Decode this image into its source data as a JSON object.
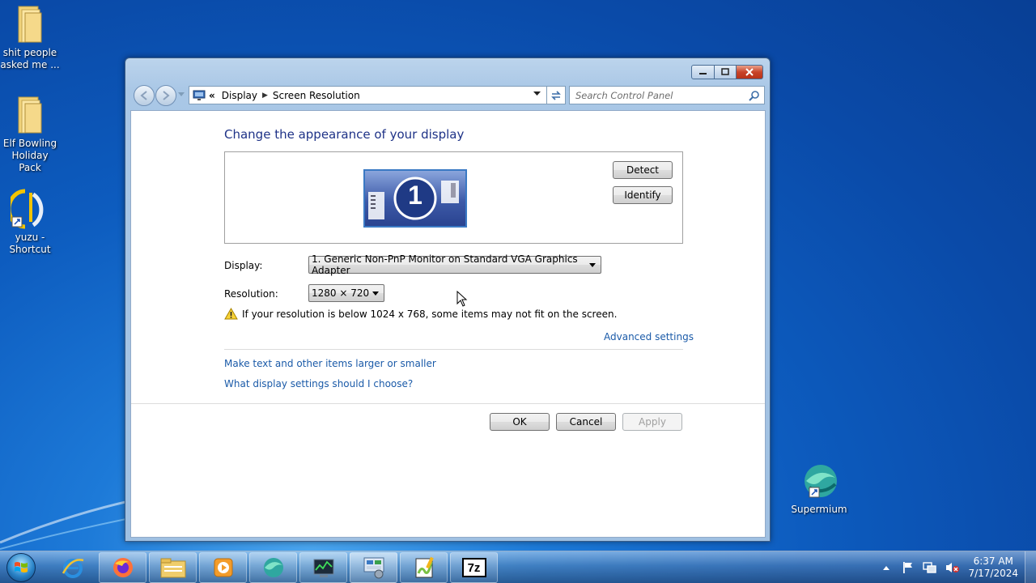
{
  "desktop": {
    "icons": [
      {
        "label": "shit people asked me ..."
      },
      {
        "label": "Elf Bowling Holiday Pack"
      },
      {
        "label": "yuzu - Shortcut"
      },
      {
        "label": "Supermium"
      }
    ]
  },
  "window": {
    "breadcrumb": {
      "overflow": "«",
      "item1": "Display",
      "item2": "Screen Resolution"
    },
    "search": {
      "placeholder": "Search Control Panel"
    },
    "heading": "Change the appearance of your display",
    "monitor_number": "1",
    "detect_label": "Detect",
    "identify_label": "Identify",
    "display": {
      "label": "Display:",
      "value": "1. Generic Non-PnP Monitor on Standard VGA Graphics Adapter"
    },
    "resolution": {
      "label": "Resolution:",
      "value": "1280 × 720"
    },
    "warning": "If your resolution is below 1024 x 768, some items may not fit on the screen.",
    "advanced_settings": "Advanced settings",
    "link_text_size": "Make text and other items larger or smaller",
    "link_choose": "What display settings should I choose?",
    "ok_label": "OK",
    "cancel_label": "Cancel",
    "apply_label": "Apply"
  },
  "taskbar": {
    "apps": [
      "internet-explorer",
      "firefox",
      "file-explorer",
      "media-player",
      "supermium",
      "task-manager",
      "control-panel",
      "notepad-plus",
      "7zip"
    ],
    "zip_label": "7z",
    "clock": {
      "time": "6:37 AM",
      "date": "7/17/2024"
    }
  }
}
